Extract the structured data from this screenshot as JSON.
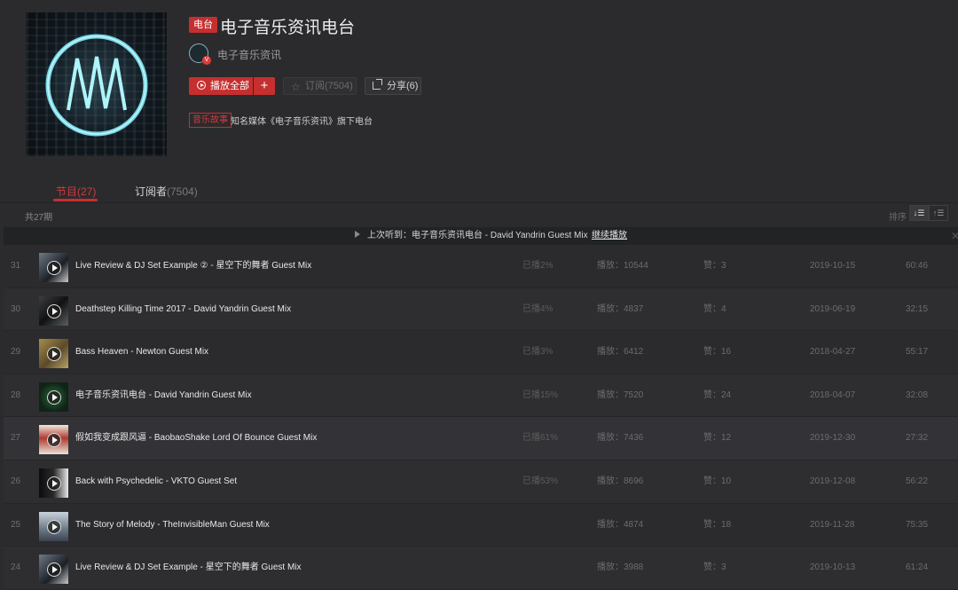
{
  "header": {
    "tag": "电台",
    "title": "电子音乐资讯电台",
    "owner": "电子音乐资讯",
    "owner_badge": "V",
    "play_all": "播放全部",
    "add": "+",
    "subscribe": "订阅(7504)",
    "share": "分享(6)",
    "category": "音乐故事",
    "description": "知名媒体《电子音乐资讯》旗下电台"
  },
  "tabs": {
    "programs": "节目(27)",
    "subscribers": "订阅者",
    "subscribers_count": "(7504)"
  },
  "list_header": {
    "count": "共27期",
    "sort": "排序",
    "sort_desc": "↓☰",
    "sort_asc": "↑☰"
  },
  "resume": {
    "text": "上次听到：电子音乐资讯电台 - David Yandrin Guest Mix",
    "action": "继续播放",
    "close": "✕"
  },
  "episodes": [
    {
      "num": "31",
      "title": "Live Review & DJ Set Example ② - 星空下的舞者 Guest Mix",
      "progress": "已播2%",
      "plays": "播放：10544",
      "likes": "赞：3",
      "date": "2019-10-15",
      "duration": "60:46"
    },
    {
      "num": "30",
      "title": "Deathstep Killing Time 2017 - David Yandrin Guest Mix",
      "progress": "已播4%",
      "plays": "播放：4837",
      "likes": "赞：4",
      "date": "2019-06-19",
      "duration": "32:15"
    },
    {
      "num": "29",
      "title": "Bass Heaven - Newton Guest Mix",
      "progress": "已播3%",
      "plays": "播放：6412",
      "likes": "赞：16",
      "date": "2018-04-27",
      "duration": "55:17"
    },
    {
      "num": "28",
      "title": "电子音乐资讯电台 - David Yandrin Guest Mix",
      "progress": "已播15%",
      "plays": "播放：7520",
      "likes": "赞：24",
      "date": "2018-04-07",
      "duration": "32:08"
    },
    {
      "num": "27",
      "title": "假如我变成跟风逼 - BaobaoShake Lord Of Bounce Guest Mix",
      "progress": "已播61%",
      "plays": "播放：7436",
      "likes": "赞：12",
      "date": "2019-12-30",
      "duration": "27:32"
    },
    {
      "num": "26",
      "title": "Back with Psychedelic - VKTO Guest Set",
      "progress": "已播53%",
      "plays": "播放：8696",
      "likes": "赞：10",
      "date": "2019-12-08",
      "duration": "56:22"
    },
    {
      "num": "25",
      "title": "The Story of Melody - TheInvisibleMan Guest Mix",
      "progress": "",
      "plays": "播放：4874",
      "likes": "赞：18",
      "date": "2019-11-28",
      "duration": "75:35"
    },
    {
      "num": "24",
      "title": "Live Review & DJ Set Example - 星空下的舞者 Guest Mix",
      "progress": "",
      "plays": "播放：3988",
      "likes": "赞：3",
      "date": "2019-10-13",
      "duration": "61:24"
    }
  ],
  "colors": {
    "accent": "#c62f2f",
    "background": "#2b2b2d",
    "resume_bar": "#212324"
  }
}
